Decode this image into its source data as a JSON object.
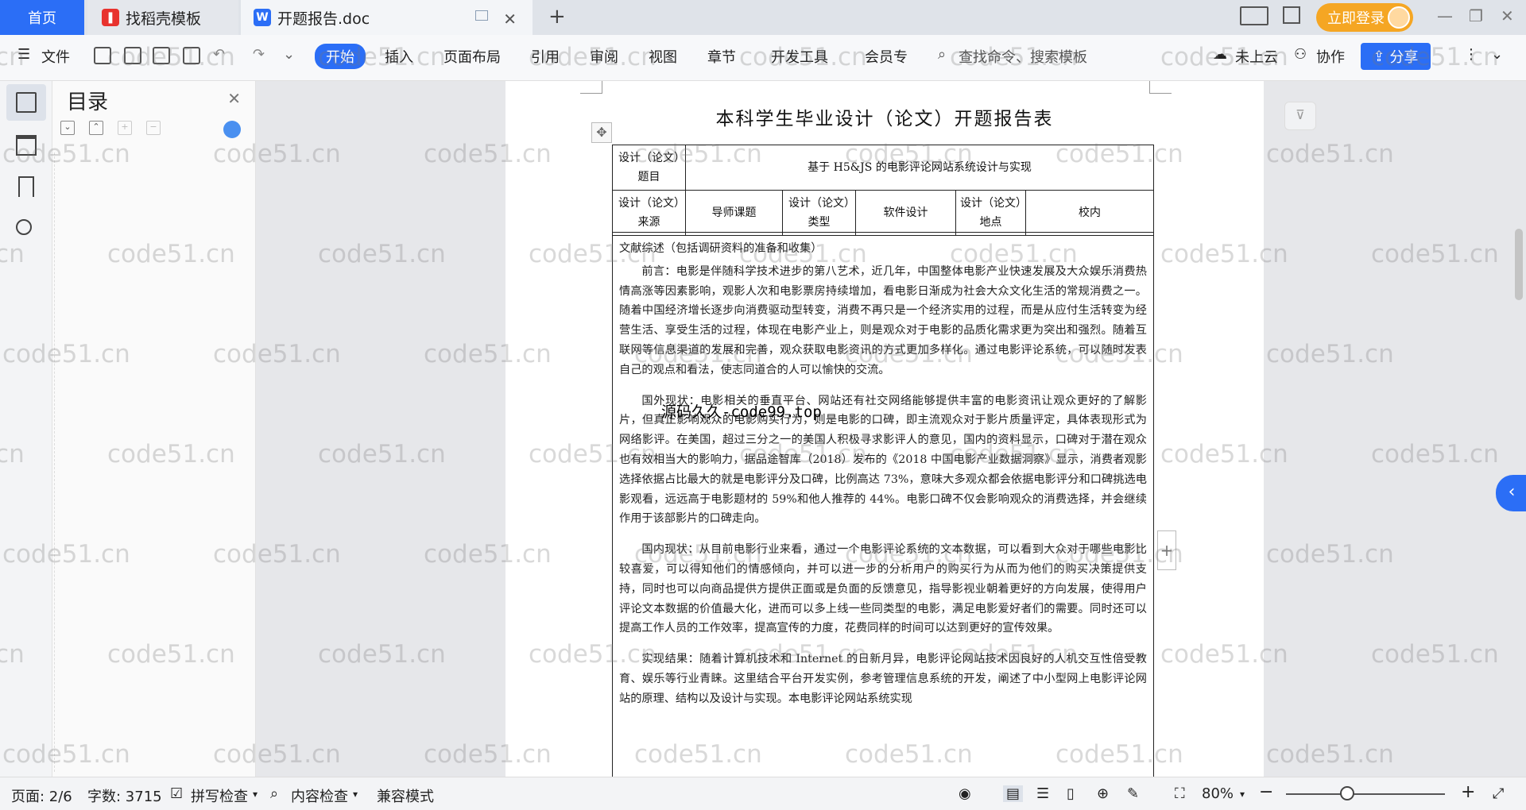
{
  "tabs": {
    "home": "首页",
    "template": "找稻壳模板",
    "doc": "开题报告.doc",
    "new_tab": "+"
  },
  "titlebar": {
    "login": "立即登录"
  },
  "ribbon": {
    "file": "文件",
    "start": "开始",
    "insert": "插入",
    "layout": "页面布局",
    "reference": "引用",
    "review": "审阅",
    "view": "视图",
    "chapter": "章节",
    "dev": "开发工具",
    "member": "会员专",
    "search_placeholder": "查找命令、搜索模板",
    "cloud": "未上云",
    "collab": "协作",
    "share": "分享"
  },
  "toc": {
    "title": "目录"
  },
  "document": {
    "title": "本科学生毕业设计（论文）开题报告表",
    "row1_label": "设计（论文）题目",
    "row1_value": "基于 H5&JS 的电影评论网站系统设计与实现",
    "source_label": "设计（论文）来源",
    "source_value": "导师课题",
    "type_label": "设计（论文）类型",
    "type_value": "软件设计",
    "place_label": "设计（论文）地点",
    "place_value": "校内",
    "section_heading": "文献综述（包括调研资料的准备和收集）",
    "para1": "前言：电影是伴随科学技术进步的第八艺术，近几年，中国整体电影产业快速发展及大众娱乐消费热情高涨等因素影响，观影人次和电影票房持续增加，看电影日渐成为社会大众文化生活的常规消费之一。随着中国经济增长逐步向消费驱动型转变，消费不再只是一个经济实用的过程，而是从应付生活转变为经营生活、享受生活的过程，体现在电影产业上，则是观众对于电影的品质化需求更为突出和强烈。随着互联网等信息渠道的发展和完善，观众获取电影资讯的方式更加多样化。通过电影评论系统，可以随时发表自己的观点和看法，使志同道合的人可以愉快的交流。",
    "para2": "国外现状：电影相关的垂直平台、网站还有社交网络能够提供丰富的电影资讯让观众更好的了解影片，但真正影响观众的电影购买行为，则是电影的口碑，即主流观众对于影片质量评定，具体表现形式为网络影评。在美国，超过三分之一的美国人积极寻求影评人的意见，国内的资料显示，口碑对于潜在观众也有效相当大的影响力，据品途智库（2018）发布的《2018 中国电影产业数据洞察》显示，消费者观影选择依据占比最大的就是电影评分及口碑，比例高达 73%，意味大多观众都会依据电影评分和口碑挑选电影观看，远远高于电影题材的 59%和他人推荐的 44%。电影口碑不仅会影响观众的消费选择，并会继续作用于该部影片的口碑走向。",
    "para3": "国内现状：从目前电影行业来看，通过一个电影评论系统的文本数据，可以看到大众对于哪些电影比较喜爱，可以得知他们的情感倾向，并可以进一步的分析用户的购买行为从而为他们的购买决策提供支持，同时也可以向商品提供方提供正面或是负面的反馈意见，指导影视业朝着更好的方向发展，使得用户评论文本数据的价值最大化，进而可以多上线一些同类型的电影，满足电影爱好者们的需要。同时还可以提高工作人员的工作效率，提高宣传的力度，花费同样的时间可以达到更好的宣传效果。",
    "para4": "实现结果：随着计算机技术和 Internet 的日新月异，电影评论网站技术因良好的人机交互性倍受教育、娱乐等行业青睐。这里结合平台开发实例，参考管理信息系统的开发，阐述了中小型网上电影评论网站的原理、结构以及设计与实现。本电影评论网站系统实现",
    "overlay": "源码久久-code99.top"
  },
  "watermark_text": "code51.cn",
  "status": {
    "page": "页面: 2/6",
    "words": "字数: 3715",
    "spell": "拼写检查",
    "content": "内容检查",
    "compat": "兼容模式",
    "zoom": "80%"
  },
  "colors": {
    "accent": "#2b6ef6",
    "login": "#f5a623"
  }
}
